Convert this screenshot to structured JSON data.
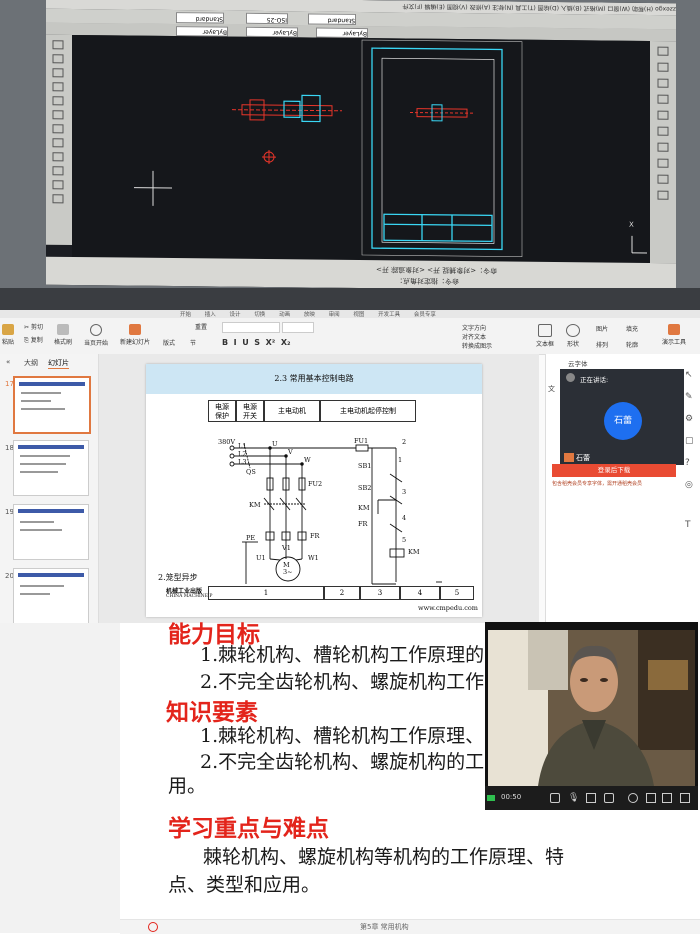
{
  "cad": {
    "menu_items": [
      "zzexgo",
      "(H)帮助",
      "(W)窗口",
      "(M)格式",
      "(B)插入",
      "(D)绘图",
      "(T)工具",
      "(N)标注",
      "(A)修改",
      "(V)视图",
      "(E)编辑",
      "(F)文件"
    ],
    "toolbar_fields": [
      "Standard",
      "ISO-25",
      "Standard"
    ],
    "layer_fields": [
      "ByLayer",
      "ByLayer",
      "ByLayer"
    ],
    "cmdline_1": "命令：<对象捕捉 开> <对象追踪 开>",
    "cmdline_2": "命令：指定对角点：",
    "coords": "X",
    "colors": {
      "canvas": "#15171b",
      "frame": "#3ad7f5",
      "drawing": "#e8352a"
    }
  },
  "wps": {
    "ribbon": {
      "top_tabs": [
        "开始",
        "插入",
        "设计",
        "切换",
        "动画",
        "放映",
        "审阅",
        "视图",
        "开发工具",
        "会员专享"
      ],
      "paste": "粘贴",
      "cut": "剪切",
      "copy": "复制",
      "format_painter": "格式刷",
      "play_from_current": "当页开始",
      "new_slide": "新建幻灯片",
      "layout": "版式",
      "section": "节",
      "reset": "重置",
      "text_box": "文本框",
      "shape": "形状",
      "arrange": "排列",
      "picture": "图片",
      "fill": "填充",
      "outline": "轮廓",
      "present_tools": "演示工具",
      "convert_smartart": "转换成图示",
      "text_direction": "文字方向",
      "align_text": "对齐文本"
    },
    "nav": {
      "tab_outline": "大纲",
      "tab_slides": "幻灯片",
      "slides": [
        {
          "num": "17",
          "selected": true
        },
        {
          "num": "18",
          "selected": false
        },
        {
          "num": "19",
          "selected": false
        },
        {
          "num": "20",
          "selected": false
        }
      ]
    },
    "slide": {
      "title": "2.3    常用基本控制电路",
      "headers": [
        "电源\n保护",
        "电源\n开关",
        "主电动机",
        "主电动机起停控制"
      ],
      "labels": {
        "v380": "380V",
        "l1": "L1",
        "l2": "L2",
        "l3": "L3",
        "qs": "QS",
        "u": "U",
        "v": "V",
        "w": "W",
        "fu1": "FU1",
        "fu2": "FU2",
        "km1": "KM",
        "km2": "KM",
        "km3": "KM",
        "fr1": "FR",
        "fr2": "FR",
        "pe": "PE",
        "u1": "U1",
        "v1": "V1",
        "w1": "W1",
        "motor": "M\n3~",
        "sb1": "SB1",
        "sb2": "SB2",
        "n1": "1",
        "n2": "2",
        "n3": "3",
        "n4": "4",
        "n5": "5",
        "caption": "2.笼型异步",
        "publisher": "机械工业出版",
        "publisher_en": "CHINA MACHINE P",
        "url": "www.cmpedu.com"
      },
      "footer_cells": [
        "1",
        "2",
        "3",
        "4",
        "5"
      ]
    },
    "right_panel": {
      "tab": "云字体",
      "speaking_label": "正在讲话:",
      "speaker_name": "石蕾",
      "speaker_tag": "石蕾",
      "login_button": "登录后下载",
      "vip_notice": "包含稻壳会员专享字体，需开通稻壳会员",
      "side_label": "文"
    }
  },
  "lesson": {
    "heading_ability": "能力目标",
    "ability_1": "1.棘轮机构、槽轮机构工作原理的",
    "ability_2": "2.不完全齿轮机构、螺旋机构工作",
    "heading_knowledge": "知识要素",
    "knowledge_1": "1.棘轮机构、槽轮机构工作原理、",
    "knowledge_2": "2.不完全齿轮机构、螺旋机构的工",
    "knowledge_2_cont": "用。",
    "heading_key": "学习重点与难点",
    "key_line_1": "棘轮机构、螺旋机构等机构的工作原理、特",
    "key_line_2": "点、类型和应用。",
    "footer_text": "第5章  常用机构"
  },
  "video": {
    "timer": "00:50",
    "controls": [
      "chat-icon",
      "mic-icon",
      "camera-off-icon",
      "video-icon",
      "snapshot-icon",
      "record-icon",
      "screen-icon",
      "more-icon"
    ]
  }
}
